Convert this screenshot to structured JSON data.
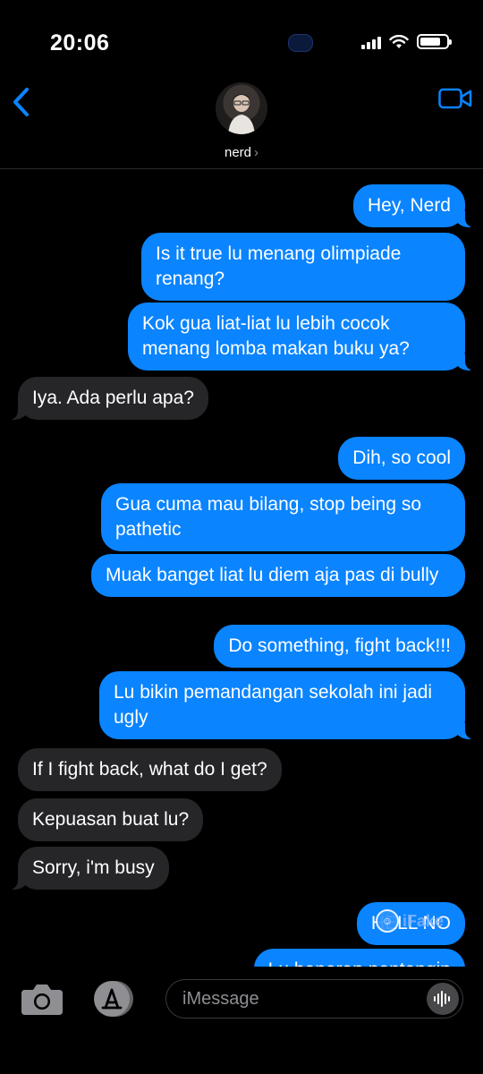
{
  "status_bar": {
    "time": "20:06"
  },
  "header": {
    "contact_name": "nerd",
    "chevron": "›"
  },
  "messages": [
    {
      "side": "sent",
      "text": "Hey, Nerd"
    },
    {
      "side": "sent",
      "text": "Is it true lu menang olimpiade renang?"
    },
    {
      "side": "sent",
      "text": "Kok gua liat-liat lu lebih cocok menang lomba makan buku ya?"
    },
    {
      "side": "received",
      "text": "Iya. Ada perlu apa?"
    },
    {
      "side": "sent",
      "text": "Dih, so cool"
    },
    {
      "side": "sent",
      "text": "Gua cuma mau bilang, stop being so pathetic"
    },
    {
      "side": "sent",
      "text": "Muak banget liat lu diem aja pas di bully"
    },
    {
      "side": "sent",
      "text": "Do something, fight back!!!"
    },
    {
      "side": "sent",
      "text": "Lu bikin pemandangan sekolah ini jadi ugly"
    },
    {
      "side": "received",
      "text": "If I fight back, what do I get?"
    },
    {
      "side": "received",
      "text": "Kepuasan buat lu?"
    },
    {
      "side": "received",
      "text": "Sorry, i'm busy"
    },
    {
      "side": "sent",
      "text": "HELL NO"
    },
    {
      "side": "sent",
      "text": "Lu beneran nentangin"
    }
  ],
  "watermark": {
    "text": "iFake"
  },
  "composer": {
    "placeholder": "iMessage"
  },
  "icons": {
    "back": "chevron-left-icon",
    "video": "video-camera-icon",
    "camera": "camera-icon",
    "apps": "app-store-icon",
    "mic": "audio-waveform-icon"
  },
  "colors": {
    "sent_bubble": "#0a84ff",
    "received_bubble": "#262629",
    "accent": "#0a84ff"
  }
}
